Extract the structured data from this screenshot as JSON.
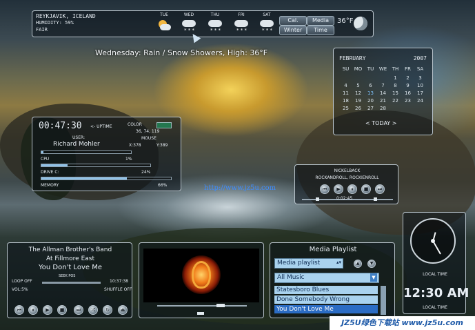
{
  "weather": {
    "location": "REYKJAVIK, ICELAND",
    "humidity": "HUMIDITY: 59%",
    "condition": "FAIR",
    "days": [
      {
        "label": "TUE",
        "icon": "partly-cloudy-icon"
      },
      {
        "label": "WED",
        "icon": "snow-icon"
      },
      {
        "label": "THU",
        "icon": "snow-icon"
      },
      {
        "label": "FRI",
        "icon": "snow-icon"
      },
      {
        "label": "SAT",
        "icon": "snow-icon"
      }
    ],
    "buttons": [
      "Cal.",
      "Media",
      "Winter",
      "Time"
    ],
    "temperature": "36°F",
    "forecast_line": "Wednesday: Rain / Snow Showers, High: 36°F"
  },
  "calendar": {
    "month": "FEBRUARY",
    "year": "2007",
    "weekdays": [
      "SU",
      "MO",
      "TU",
      "WE",
      "TH",
      "FR",
      "SA"
    ],
    "weeks": [
      [
        "",
        "",
        "",
        "",
        "1",
        "2",
        "3"
      ],
      [
        "4",
        "5",
        "6",
        "7",
        "8",
        "9",
        "10"
      ],
      [
        "11",
        "12",
        "13",
        "14",
        "15",
        "16",
        "17"
      ],
      [
        "18",
        "19",
        "20",
        "21",
        "22",
        "23",
        "24"
      ],
      [
        "25",
        "26",
        "27",
        "28",
        "",
        "",
        ""
      ]
    ],
    "today_label": "< TODAY >",
    "highlight": "13"
  },
  "system": {
    "time": "00:47:30",
    "uptime_label": "<- UPTIME",
    "color_label": "COLOR",
    "color_values": "36, 74, 119",
    "user_label": "USER:",
    "user": "Richard Mohler",
    "mouse_label": "MOUSE",
    "mouse_x": "X:378",
    "mouse_y": "Y:389",
    "cpu_label": "CPU",
    "cpu_value": "1%",
    "cpu_fill": 0.02,
    "drive_label": "DRIVE C:",
    "drive_value": "24%",
    "drive_fill": 0.24,
    "memory_label": "MEMORY",
    "memory_value": "66%",
    "memory_fill": 0.66
  },
  "now_playing_top": {
    "header": "NICKELBACK",
    "subheader": "ROCKANDROLL, ROCKIENROLL",
    "time": "0:02:45"
  },
  "watermark_url": "http://www.jz5u.com",
  "music": {
    "line1": "The Allman Brother's Band",
    "line2": "At Fillmore East",
    "line3": "You Don't Love Me",
    "loop": "LOOP OFF",
    "shuffle": "SHUFFLE OFF",
    "volume": "VOL:5%",
    "remaining": "10:37:38",
    "seek_label": "SEEK POS"
  },
  "playlist": {
    "title": "Media Playlist",
    "dropdown": "Media playlist",
    "filter": "All Music",
    "items": [
      "Statesboro Blues",
      "Done Somebody Wrong",
      "You Don't Love Me"
    ],
    "selected_index": 2
  },
  "clock": {
    "label": "LOCAL TIME",
    "digital": "12:30 AM",
    "subtitle": "LOCAL TIME"
  },
  "site_badge": "JZ5U绿色下载站 www.jz5u.com"
}
